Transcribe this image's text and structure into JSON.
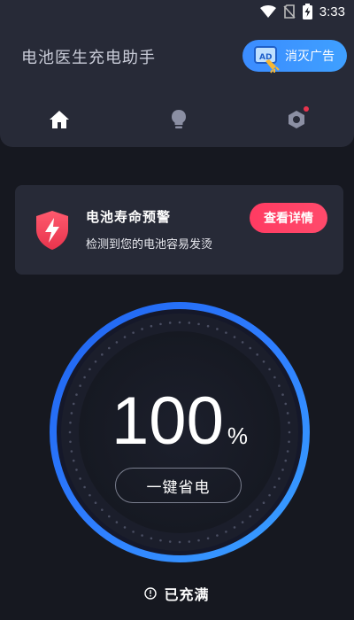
{
  "status_bar": {
    "time": "3:33",
    "icons": [
      "wifi-icon",
      "no-sim-icon",
      "battery-charging-icon"
    ]
  },
  "header": {
    "app_title": "电池医生充电助手",
    "ad_button_label": "消灭广告",
    "nav": {
      "items": [
        {
          "name": "home",
          "icon": "home-icon",
          "active": true
        },
        {
          "name": "tips",
          "icon": "lightbulb-icon",
          "active": false
        },
        {
          "name": "settings",
          "icon": "hex-nut-settings-icon",
          "active": false,
          "badge": true
        }
      ]
    }
  },
  "alert": {
    "title": "电池寿命预警",
    "subtitle": "检测到您的电池容易发烫",
    "button_label": "查看详情",
    "icon": "shield-lightning-icon"
  },
  "gauge": {
    "percent": "100",
    "percent_sign": "%",
    "level": 1.0,
    "save_button_label": "一键省电"
  },
  "charge_status": {
    "text": "已充满",
    "icon": "info-icon"
  },
  "colors": {
    "background": "#161820",
    "panel": "#272a37",
    "accent_blue": "#3b8cff",
    "accent_red": "#ff3b62"
  }
}
